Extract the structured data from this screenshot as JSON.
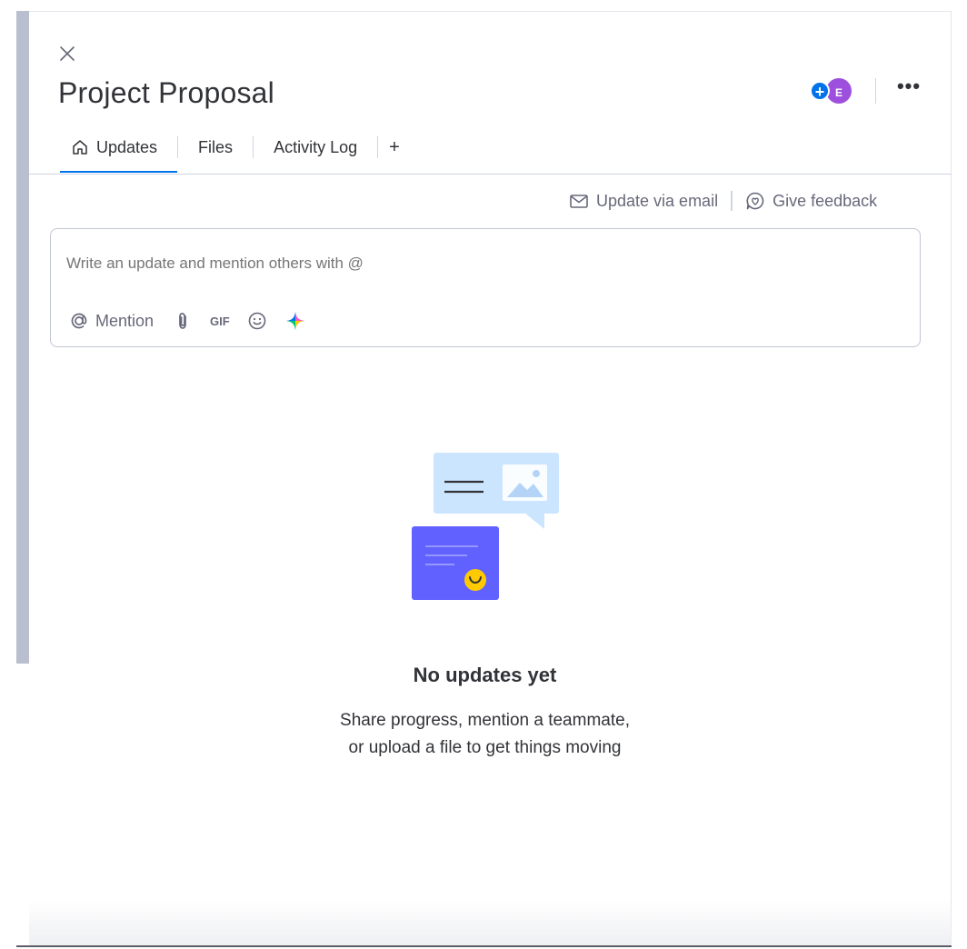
{
  "panel": {
    "title": "Project Proposal"
  },
  "header": {
    "add_person_symbol": "+",
    "avatar_initial": "E",
    "more_symbol": "•••"
  },
  "tabs": [
    {
      "label": "Updates",
      "active": true
    },
    {
      "label": "Files",
      "active": false
    },
    {
      "label": "Activity Log",
      "active": false
    }
  ],
  "add_tab_symbol": "+",
  "links": {
    "update_via_email": "Update via email",
    "give_feedback": "Give feedback"
  },
  "composer": {
    "placeholder": "Write an update and mention others with @",
    "mention_label": "Mention",
    "gif_label": "GIF"
  },
  "empty_state": {
    "title": "No updates yet",
    "line1": "Share progress, mention a teammate,",
    "line2": "or upload a file to get things moving"
  },
  "colors": {
    "accent": "#0073ea",
    "avatar": "#9d50dd",
    "illustration_card": "#6161ff",
    "illustration_bubble": "#cce5ff",
    "smile": "#ffcb00"
  }
}
